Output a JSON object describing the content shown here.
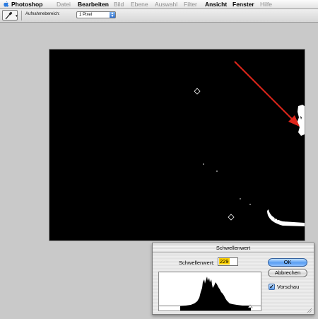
{
  "menubar": {
    "items": [
      {
        "label": "Photoshop",
        "state": "active"
      },
      {
        "label": "Datei",
        "state": "disabled"
      },
      {
        "label": "Bearbeiten",
        "state": "active"
      },
      {
        "label": "Bild",
        "state": "disabled"
      },
      {
        "label": "Ebene",
        "state": "disabled"
      },
      {
        "label": "Auswahl",
        "state": "disabled"
      },
      {
        "label": "Filter",
        "state": "disabled"
      },
      {
        "label": "Ansicht",
        "state": "active"
      },
      {
        "label": "Fenster",
        "state": "active"
      },
      {
        "label": "Hilfe",
        "state": "disabled"
      }
    ]
  },
  "options_bar": {
    "tool_icon": "eyedropper-icon",
    "sample_label": "Aufnahmebereich:",
    "sample_value": "1 Pixel"
  },
  "document": {
    "annotation_arrow_color": "#e0261b",
    "canvas_color": "#000000"
  },
  "dialog": {
    "title": "Schwellenwert",
    "threshold_label": "Schwellenwert:",
    "threshold_value": "229",
    "ok_label": "OK",
    "cancel_label": "Abbrechen",
    "preview_label": "Vorschau",
    "preview_checked": true,
    "slider_level": 229
  }
}
